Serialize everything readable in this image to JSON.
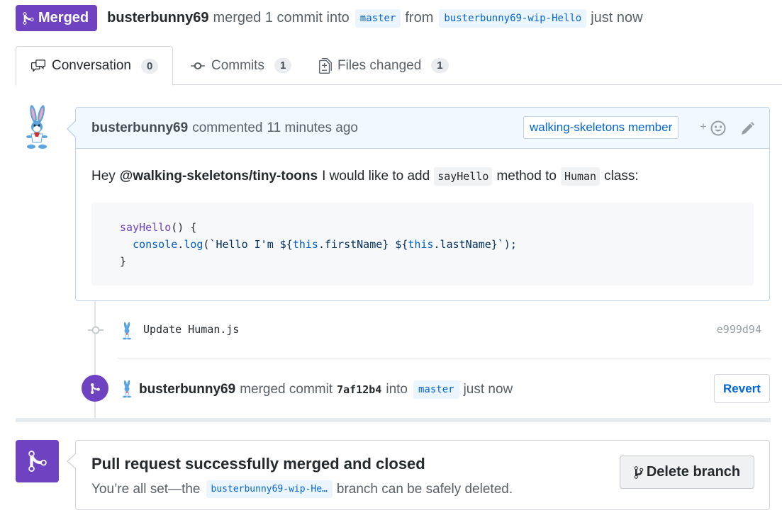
{
  "colors": {
    "merged_purple": "#6f42c1",
    "link_blue": "#0366d6",
    "muted_text": "#586069"
  },
  "header": {
    "state_label": "Merged",
    "state_icon": "git-merge-icon",
    "author": "busterbunny69",
    "action_text": "merged 1 commit into",
    "base_branch": "master",
    "from_text": "from",
    "head_branch": "busterbunny69-wip-Hello",
    "time_text": "just now"
  },
  "tabs": [
    {
      "label": "Conversation",
      "count": "0",
      "icon": "comment-discussion-icon",
      "active": true
    },
    {
      "label": "Commits",
      "count": "1",
      "icon": "git-commit-icon",
      "active": false
    },
    {
      "label": "Files changed",
      "count": "1",
      "icon": "file-diff-icon",
      "active": false
    }
  ],
  "comment": {
    "author": "busterbunny69",
    "action": "commented",
    "time": "11 minutes ago",
    "role_badge": "walking-skeletons member",
    "reaction_plus": "+",
    "body_prefix": "Hey",
    "mention": "@walking-skeletons/tiny-toons",
    "body_mid": "I would like to add",
    "code_method": "sayHello",
    "body_mid2": "method to",
    "code_class": "Human",
    "body_suffix": "class:",
    "code_lines": {
      "l1_fn": "sayHello",
      "l1_rest": "() {",
      "l2_obj": "console",
      "l2_dot": ".",
      "l2_method": "log",
      "l2_open": "(",
      "l2_str1": "`Hello I'm ${",
      "l2_this1": "this",
      "l2_mid": ".firstName} ${",
      "l2_this2": "this",
      "l2_end": ".lastName}`);",
      "l3": "}"
    }
  },
  "commit": {
    "message": "Update Human.js",
    "sha": "e999d94"
  },
  "merge_event": {
    "author": "busterbunny69",
    "text": "merged commit",
    "sha": "7af12b4",
    "into_text": "into",
    "branch": "master",
    "time": "just now",
    "revert_label": "Revert"
  },
  "status": {
    "title": "Pull request successfully merged and closed",
    "desc_prefix": "You’re all set—the",
    "branch": "busterbunny69-wip-He…",
    "desc_suffix": "branch can be safely deleted.",
    "delete_label": "Delete branch"
  }
}
